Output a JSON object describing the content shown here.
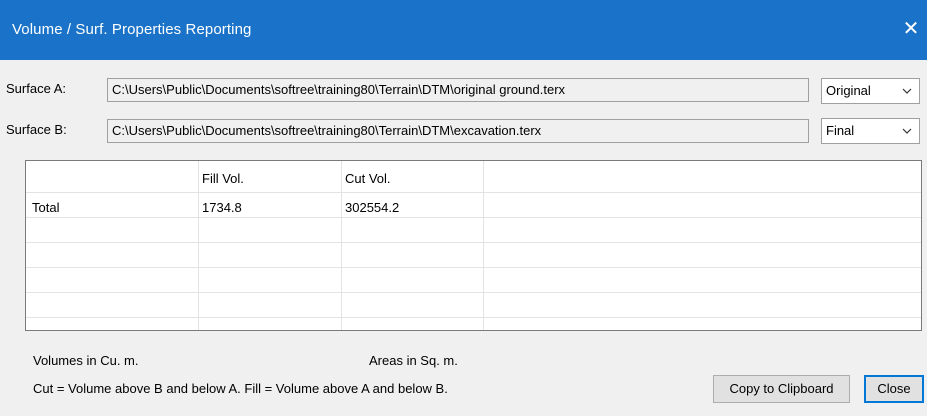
{
  "window": {
    "title": "Volume / Surf. Properties Reporting",
    "close_glyph": "✕"
  },
  "surface_a": {
    "label": "Surface A:",
    "path": "C:\\Users\\Public\\Documents\\softree\\training80\\Terrain\\DTM\\original ground.terx",
    "selection": "Original"
  },
  "surface_b": {
    "label": "Surface B:",
    "path": "C:\\Users\\Public\\Documents\\softree\\training80\\Terrain\\DTM\\excavation.terx",
    "selection": "Final"
  },
  "table": {
    "columns": [
      "",
      "Fill Vol.",
      "Cut Vol."
    ],
    "rows": [
      {
        "name": "Total",
        "fill": "1734.8",
        "cut": "302554.2"
      }
    ]
  },
  "notes": {
    "volume_units": "Volumes in Cu. m.",
    "area_units": "Areas in Sq. m.",
    "definition": "Cut = Volume above B and below A.  Fill = Volume above A and below B."
  },
  "buttons": {
    "copy": "Copy to Clipboard",
    "close": "Close"
  },
  "icons": {
    "dropdown": "chevron-down-icon",
    "close": "close-icon"
  }
}
